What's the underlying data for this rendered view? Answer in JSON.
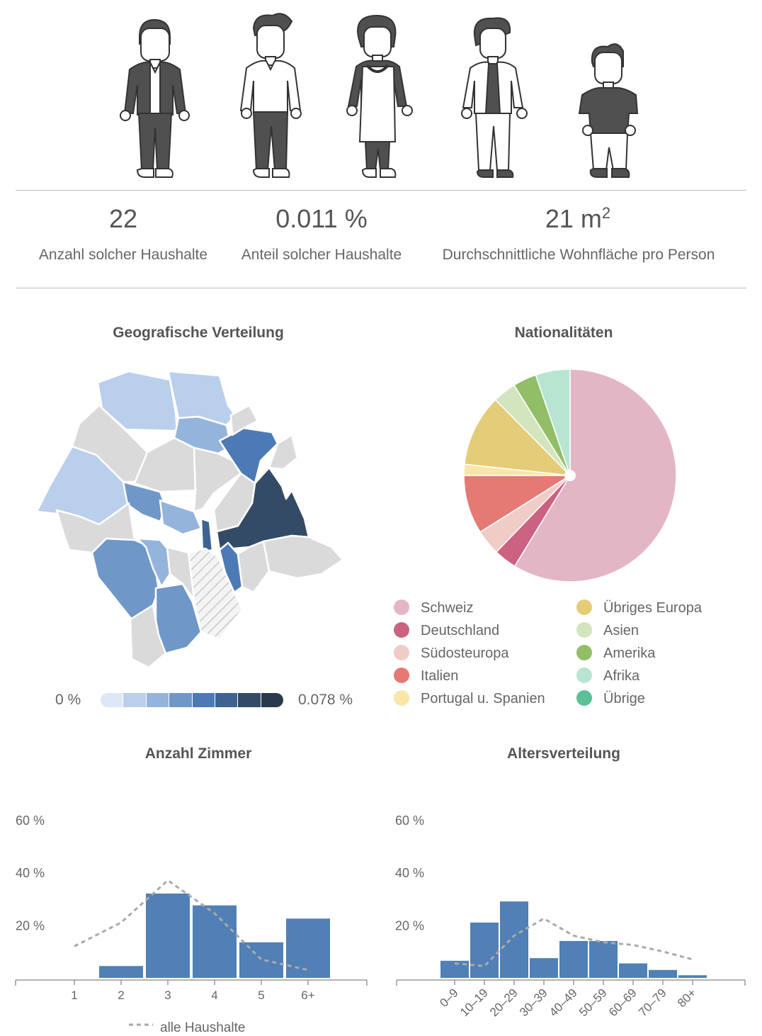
{
  "stats": [
    {
      "value": "22",
      "label": "Anzahl solcher Haushalte"
    },
    {
      "value": "0.011 %",
      "label": "Anteil solcher Haushalte"
    },
    {
      "value": "21 m",
      "sup": "2",
      "label": "Durchschnittliche Wohnfläche pro Person"
    }
  ],
  "people_icons": [
    "man-suit-icon",
    "man-shirt-icon",
    "woman-dress-icon",
    "woman-blazer-icon",
    "boy-icon"
  ],
  "geo": {
    "title": "Geografische Verteilung",
    "scale_min": "0 %",
    "scale_max": "0.078 %",
    "scale_colors": [
      "#dde7f6",
      "#b9cfec",
      "#95b4dc",
      "#6f97c8",
      "#4c7ab4",
      "#3d6391",
      "#334b66",
      "#2a3a4c"
    ]
  },
  "nationalities": {
    "title": "Nationalitäten",
    "legend": [
      {
        "label": "Schweiz",
        "color": "#e3b6c6"
      },
      {
        "label": "Deutschland",
        "color": "#cc6282"
      },
      {
        "label": "Südosteuropa",
        "color": "#efcdc6"
      },
      {
        "label": "Italien",
        "color": "#e57a74"
      },
      {
        "label": "Portugal u. Spanien",
        "color": "#fae6a9"
      },
      {
        "label": "Übriges Europa",
        "color": "#e5cc78"
      },
      {
        "label": "Asien",
        "color": "#d3e5bd"
      },
      {
        "label": "Amerika",
        "color": "#91be66"
      },
      {
        "label": "Afrika",
        "color": "#b8e5d2"
      },
      {
        "label": "Übrige",
        "color": "#5bbf98"
      }
    ]
  },
  "chart_data": [
    {
      "type": "pie",
      "title": "Nationalitäten",
      "categories": [
        "Schweiz",
        "Deutschland",
        "Südosteuropa",
        "Italien",
        "Portugal u. Spanien",
        "Übriges Europa",
        "Asien",
        "Amerika",
        "Afrika",
        "Übrige"
      ],
      "values": [
        59.2,
        3.5,
        3.9,
        9.0,
        1.7,
        11.0,
        3.6,
        3.6,
        5.3,
        0
      ],
      "colors": [
        "#e3b6c6",
        "#cc6282",
        "#efcdc6",
        "#e57a74",
        "#fae6a9",
        "#e5cc78",
        "#d3e5bd",
        "#91be66",
        "#b8e5d2",
        "#5bbf98"
      ]
    },
    {
      "type": "bar",
      "title": "Anzahl Zimmer",
      "categories": [
        "1",
        "2",
        "3",
        "4",
        "5",
        "6+"
      ],
      "yticks": [
        "20 %",
        "40 %",
        "60 %"
      ],
      "ylim": [
        0,
        60
      ],
      "bar_color": "#5080b5",
      "series": [
        {
          "values": [
            0,
            4.5,
            32,
            27.5,
            13.5,
            22.5
          ]
        },
        {
          "name": "alle Haushalte",
          "style": "dashed",
          "values": [
            12,
            21,
            37,
            24.5,
            7,
            3
          ]
        }
      ]
    },
    {
      "type": "bar",
      "title": "Altersverteilung",
      "categories": [
        "0–9",
        "10–19",
        "20–29",
        "30–39",
        "40–49",
        "50–59",
        "60–69",
        "70–79",
        "80+"
      ],
      "yticks": [
        "20 %",
        "40 %",
        "60 %"
      ],
      "ylim": [
        0,
        60
      ],
      "bar_color": "#5080b5",
      "series": [
        {
          "values": [
            6.5,
            21,
            29,
            7.5,
            14,
            14,
            5.5,
            3,
            1
          ]
        },
        {
          "name": "alle Haushalte",
          "style": "dashed",
          "values": [
            5.5,
            4.5,
            16,
            22.5,
            16,
            13.5,
            12.5,
            10,
            7
          ]
        }
      ]
    }
  ],
  "legend_line_label": "alle Haushalte"
}
